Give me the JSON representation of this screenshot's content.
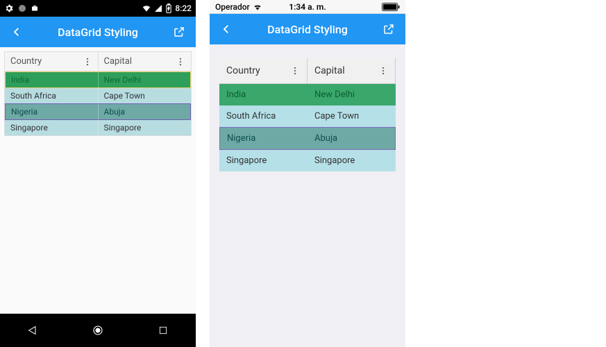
{
  "android": {
    "status": {
      "time": "8:22"
    },
    "appbar": {
      "title": "DataGrid Styling"
    },
    "grid": {
      "headers": {
        "country": "Country",
        "capital": "Capital"
      },
      "rows": [
        {
          "country": "India",
          "capital": "New Delhi",
          "style": "row-sel-green"
        },
        {
          "country": "South Africa",
          "capital": "Cape Town",
          "style": "row-alt"
        },
        {
          "country": "Nigeria",
          "capital": "Abuja",
          "style": "row-sel-teal"
        },
        {
          "country": "Singapore",
          "capital": "Singapore",
          "style": "row-alt"
        }
      ]
    }
  },
  "ios": {
    "status": {
      "carrier": "Operador",
      "time": "1:34 a. m."
    },
    "appbar": {
      "title": "DataGrid Styling"
    },
    "grid": {
      "headers": {
        "country": "Country",
        "capital": "Capital"
      },
      "rows": [
        {
          "country": "India",
          "capital": "New Delhi",
          "style": "row-sel-green"
        },
        {
          "country": "South Africa",
          "capital": "Cape Town",
          "style": "row-alt"
        },
        {
          "country": "Nigeria",
          "capital": "Abuja",
          "style": "row-sel-teal"
        },
        {
          "country": "Singapore",
          "capital": "Singapore",
          "style": "row-alt"
        }
      ]
    }
  }
}
